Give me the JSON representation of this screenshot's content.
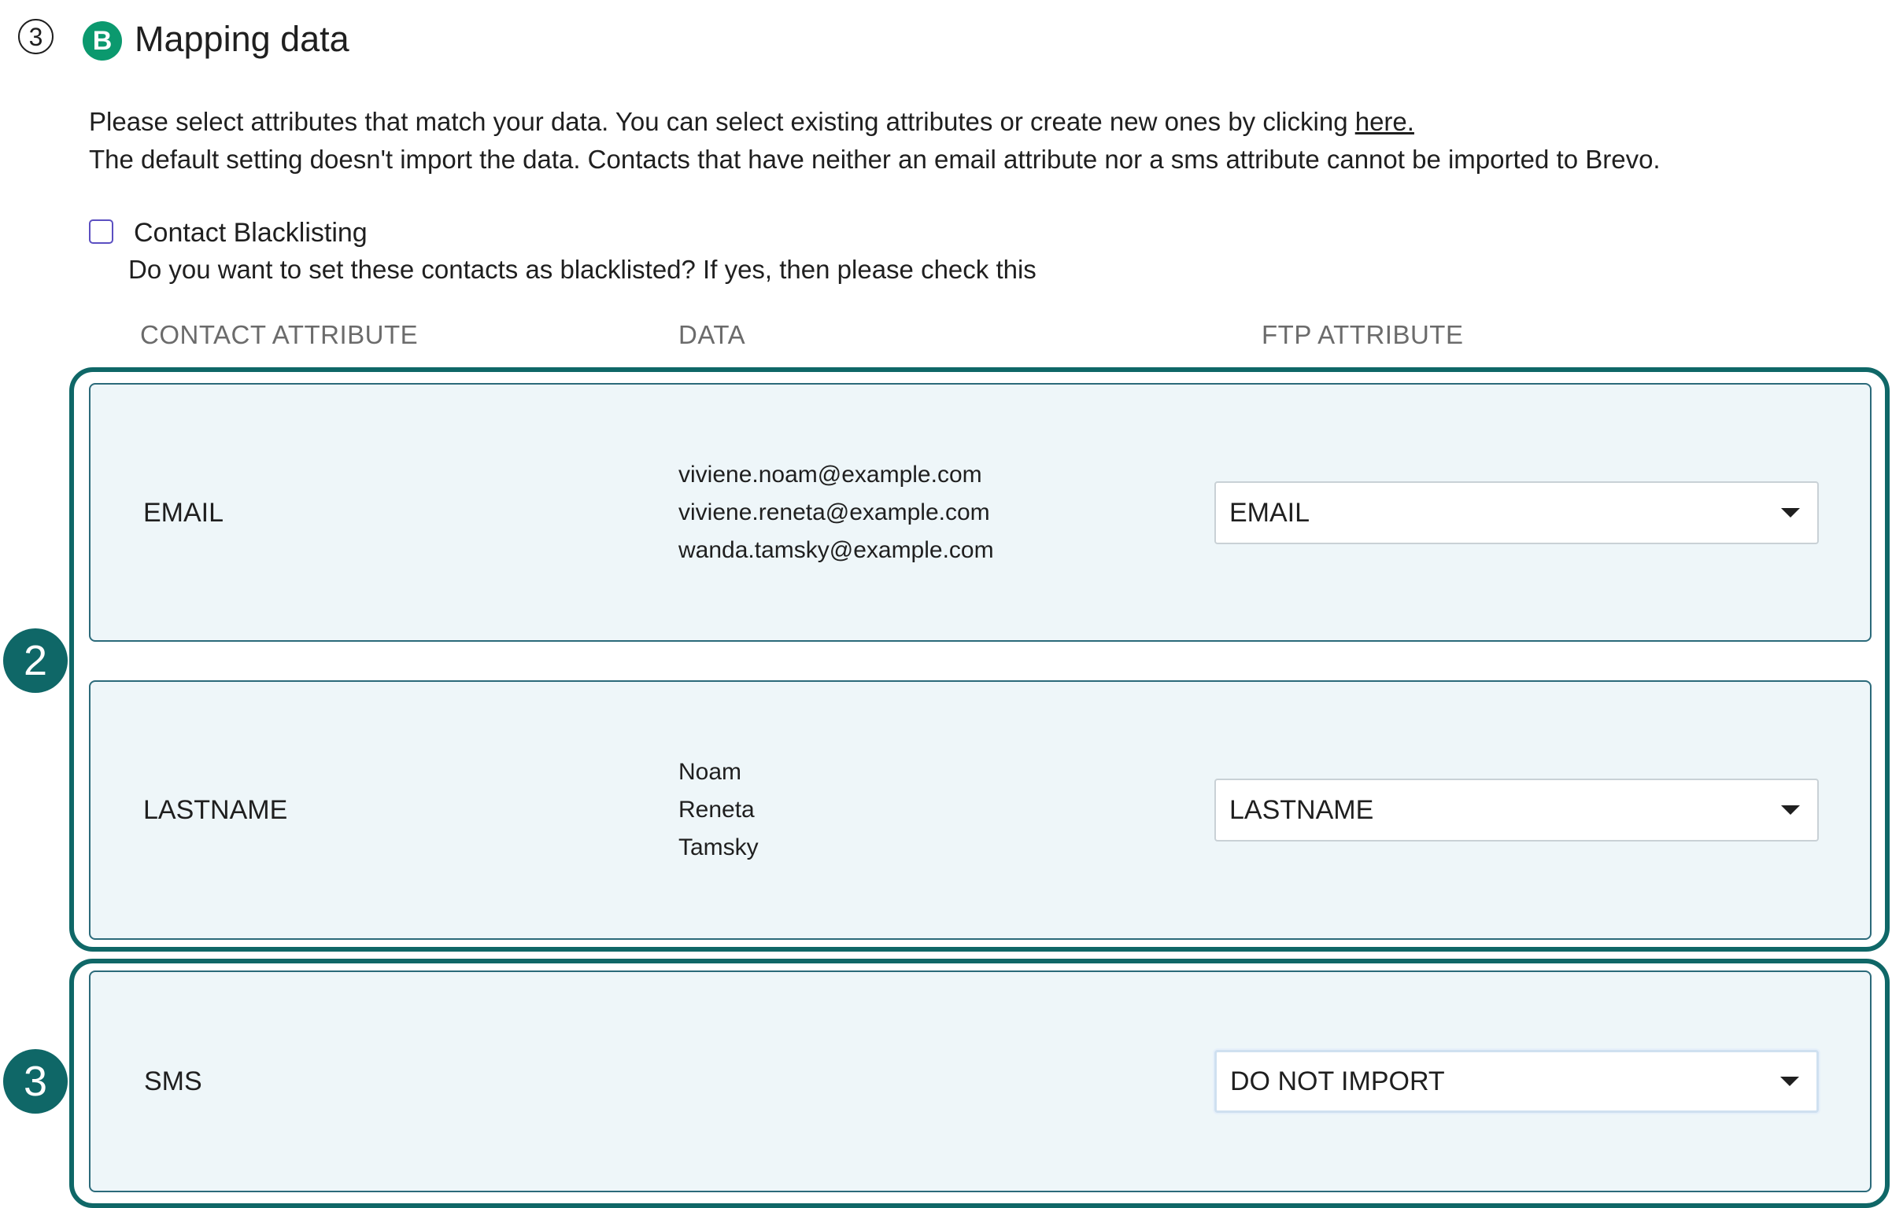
{
  "step": {
    "number": "3",
    "brand_icon_letter": "B",
    "brand_color": "#0b996e",
    "title": "Mapping data"
  },
  "intro": {
    "line1_prefix": "Please select attributes that match your data. You can select existing attributes or create new ones by clicking ",
    "line1_link": "here.",
    "line2": "The default setting doesn't import the data. Contacts that have neither an email attribute nor a sms attribute cannot be imported to Brevo."
  },
  "blacklisting": {
    "label": "Contact Blacklisting",
    "help": "Do you want to set these contacts as blacklisted? If yes, then please check this",
    "checked": false
  },
  "columns": {
    "contact_attribute": "CONTACT ATTRIBUTE",
    "data": "DATA",
    "ftp_attribute": "FTP ATTRIBUTE"
  },
  "annotations": {
    "marker_2": "2",
    "marker_3": "3",
    "highlight_color": "#0f6767"
  },
  "rows": [
    {
      "attribute": "EMAIL",
      "data": [
        "viviene.noam@example.com",
        "viviene.reneta@example.com",
        "wanda.tamsky@example.com"
      ],
      "ftp_attribute": "EMAIL"
    },
    {
      "attribute": "LASTNAME",
      "data": [
        "Noam",
        "Reneta",
        "Tamsky"
      ],
      "ftp_attribute": "LASTNAME"
    },
    {
      "attribute": "SMS",
      "data": [],
      "ftp_attribute": "DO NOT IMPORT"
    }
  ]
}
